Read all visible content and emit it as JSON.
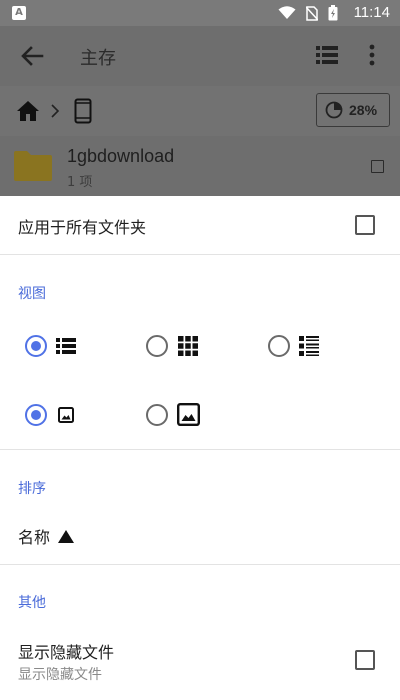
{
  "status_bar": {
    "time": "11:14",
    "app_icon_letter": "A",
    "icons": [
      "wifi-icon",
      "no-sim-icon",
      "battery-charging-icon"
    ]
  },
  "app_bar": {
    "title": "主存",
    "back_icon": "arrow-back-icon",
    "view_icon": "view-list-icon",
    "more_icon": "more-vert-icon"
  },
  "breadcrumb": {
    "items": [
      "home-icon",
      "phone-icon"
    ],
    "storage_percent": "28%"
  },
  "file_list": [
    {
      "name": "1gbdownload",
      "subtitle": "1 项",
      "icon": "folder-icon"
    }
  ],
  "sheet": {
    "apply_all_label": "应用于所有文件夹",
    "apply_all_checked": false,
    "view_section": "视图",
    "view_options": [
      {
        "icon": "view-list-icon",
        "selected": true
      },
      {
        "icon": "view-grid-icon",
        "selected": false
      },
      {
        "icon": "view-detail-list-icon",
        "selected": false
      },
      {
        "icon": "thumbnail-small-icon",
        "selected": true
      },
      {
        "icon": "thumbnail-large-icon",
        "selected": false
      }
    ],
    "sort_section": "排序",
    "sort_label": "名称",
    "sort_direction_icon": "triangle-up-icon",
    "other_section": "其他",
    "show_hidden_label": "显示隐藏文件",
    "show_hidden_sub": "显示隐藏文件",
    "show_hidden_checked": false
  },
  "colors": {
    "accent": "#5072e6",
    "dim_overlay": "#6e6e6e",
    "folder": "#8a7420"
  }
}
